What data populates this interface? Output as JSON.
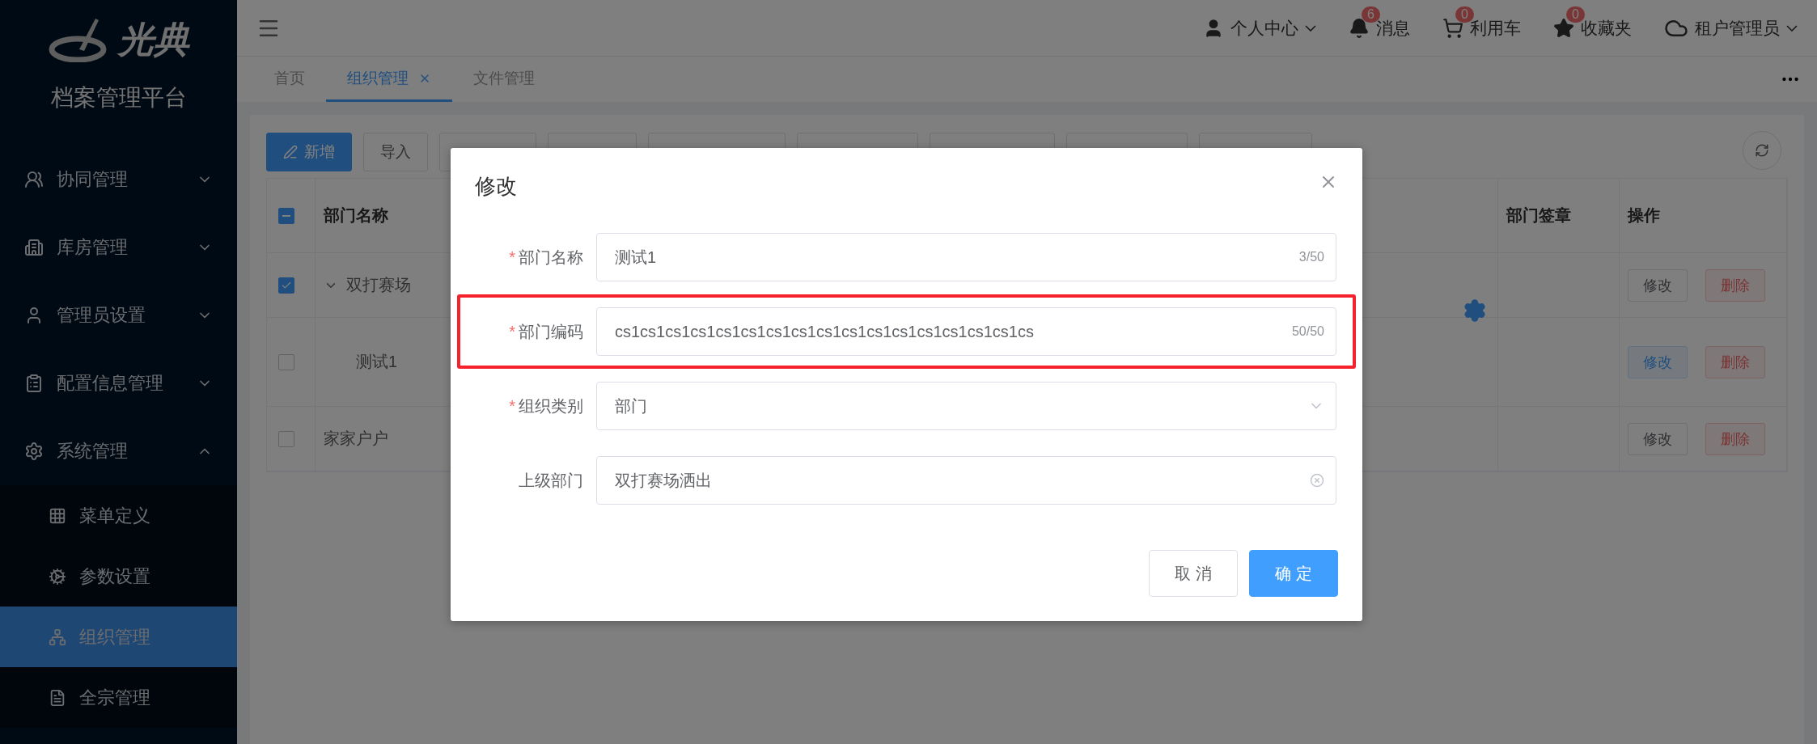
{
  "sidebar": {
    "logo_text": "光典",
    "title": "档案管理平台",
    "items": [
      {
        "label": "协同管理",
        "expanded": false
      },
      {
        "label": "库房管理",
        "expanded": false
      },
      {
        "label": "管理员设置",
        "expanded": false
      },
      {
        "label": "配置信息管理",
        "expanded": false
      },
      {
        "label": "系统管理",
        "expanded": true,
        "children": [
          {
            "label": "菜单定义",
            "selected": false
          },
          {
            "label": "参数设置",
            "selected": false
          },
          {
            "label": "组织管理",
            "selected": true
          },
          {
            "label": "全宗管理",
            "selected": false
          }
        ]
      }
    ]
  },
  "header": {
    "user_menu": "个人中心",
    "shortcuts": [
      {
        "label": "消息",
        "count": "6"
      },
      {
        "label": "利用车",
        "count": "0"
      },
      {
        "label": "收藏夹",
        "count": "0"
      }
    ],
    "tenant": "租户管理员"
  },
  "tabs": [
    {
      "label": "首页",
      "selected": false,
      "closable": false
    },
    {
      "label": "组织管理",
      "selected": true,
      "closable": true
    },
    {
      "label": "文件管理",
      "selected": false,
      "closable": false
    }
  ],
  "toolbar": {
    "buttons": [
      {
        "kind": "primary",
        "label": "新增"
      },
      {
        "kind": "default",
        "label": "导入"
      },
      {
        "kind": "covered"
      },
      {
        "kind": "covered"
      },
      {
        "kind": "covered"
      },
      {
        "kind": "covered"
      },
      {
        "kind": "covered"
      },
      {
        "kind": "covered"
      },
      {
        "kind": "covered"
      }
    ]
  },
  "table": {
    "header_checkbox": {
      "indeterminate": true
    },
    "columns": [
      "部门名称",
      "部门签章",
      "操作"
    ],
    "rows": [
      {
        "name": "双打赛场",
        "checked": true,
        "expanded": true,
        "actions": [
          {
            "kind": "edit",
            "label": "修改",
            "hovered": false
          },
          {
            "kind": "delete",
            "label": "删除"
          }
        ],
        "children": [
          {
            "name": "测试1",
            "checked": false,
            "actions": [
              {
                "kind": "edit",
                "label": "修改",
                "hovered": true
              },
              {
                "kind": "delete",
                "label": "删除"
              }
            ]
          }
        ]
      },
      {
        "name": "家家户户",
        "checked": false,
        "actions": [
          {
            "kind": "edit",
            "label": "修改",
            "hovered": false
          },
          {
            "kind": "delete",
            "label": "删除"
          }
        ]
      }
    ]
  },
  "dialog": {
    "title": "修改",
    "fields": [
      {
        "kind": "text",
        "required_mark": "*",
        "label": "部门名称",
        "value": "测试1",
        "counter": "3/50",
        "highlighted": false
      },
      {
        "kind": "text",
        "required_mark": "*",
        "label": "部门编码",
        "value": "cs1cs1cs1cs1cs1cs1cs1cs1cs1cs1cs1cs1cs1cs1cs1cs1cs",
        "counter": "50/50",
        "highlighted": true
      },
      {
        "kind": "select",
        "required_mark": "*",
        "label": "组织类别",
        "value": "部门",
        "highlighted": false
      },
      {
        "kind": "clearable",
        "label": "上级部门",
        "value": "双打赛场洒出",
        "highlighted": false
      }
    ],
    "buttons": [
      {
        "label": "取 消",
        "primary": false
      },
      {
        "label": "确 定",
        "primary": true
      }
    ]
  }
}
